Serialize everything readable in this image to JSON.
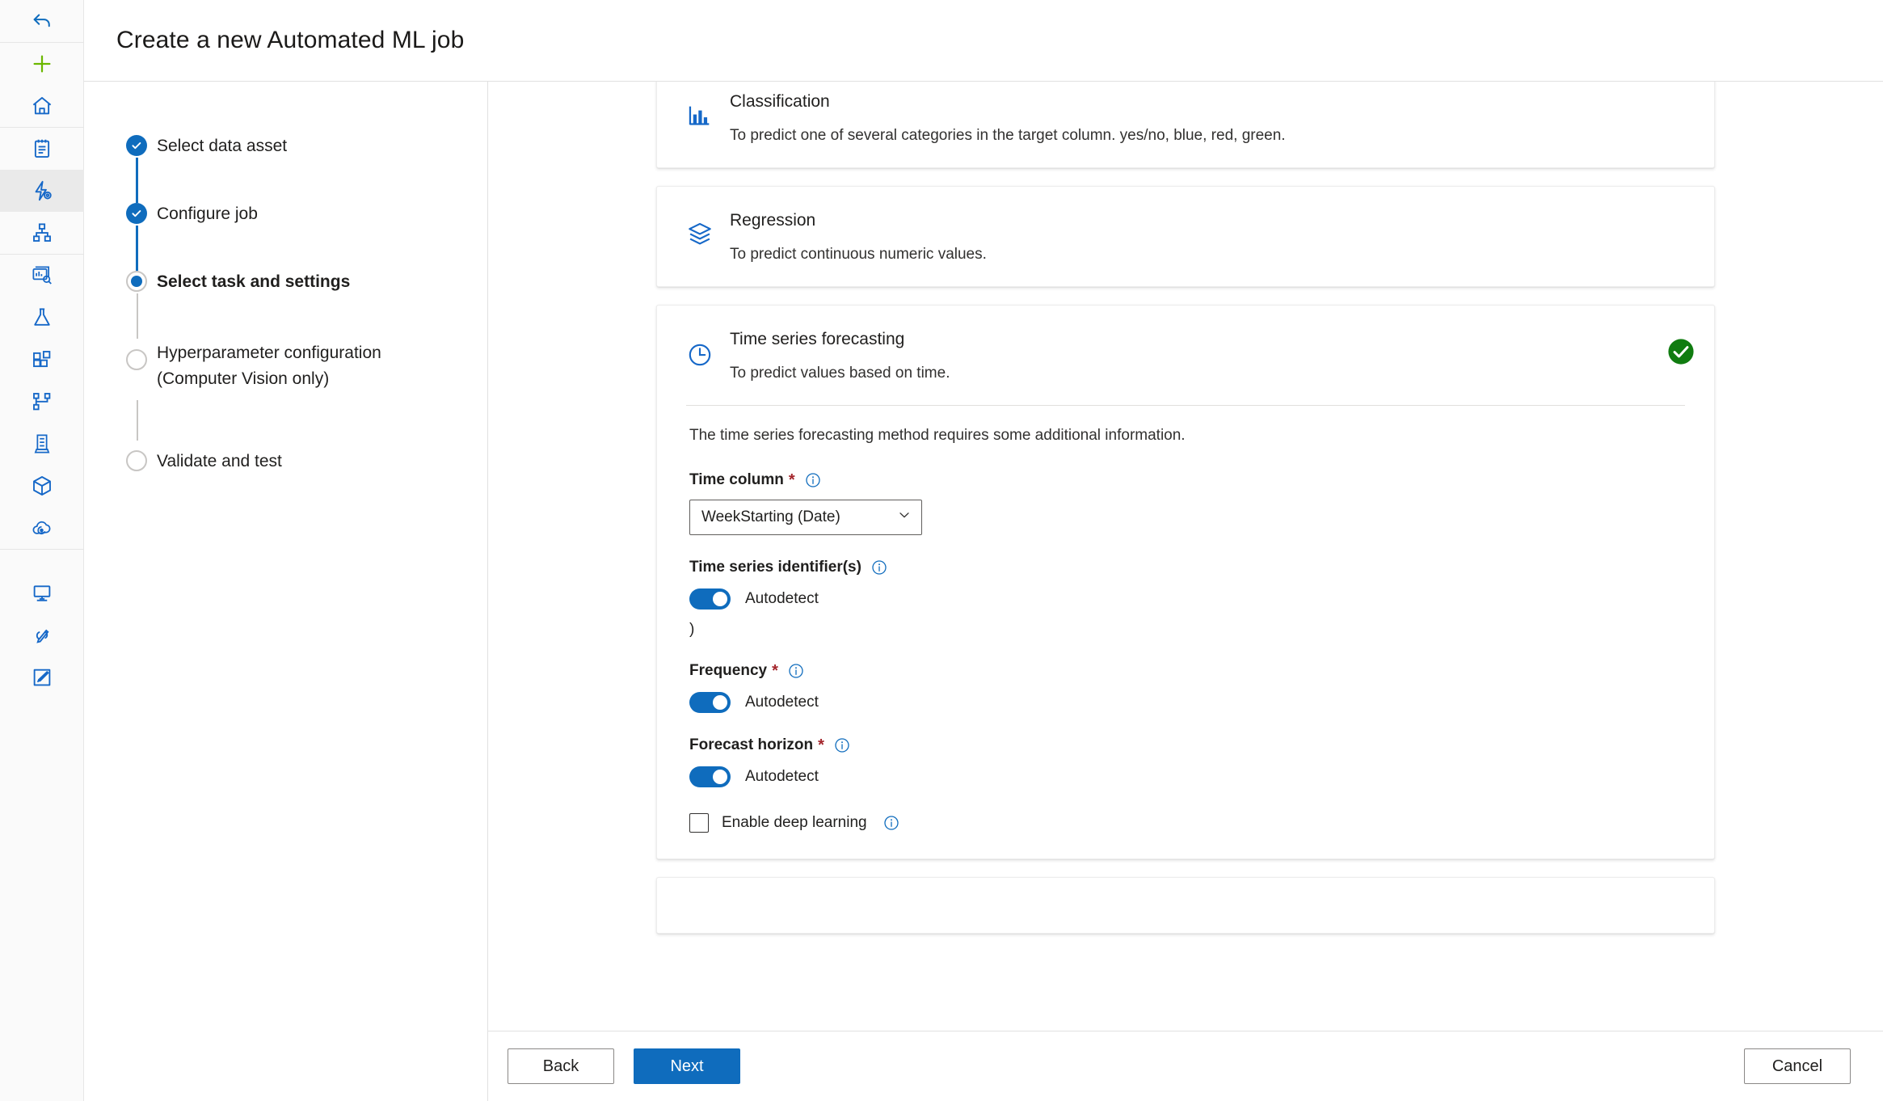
{
  "header": {
    "title": "Create a new Automated ML job"
  },
  "rail": {
    "items": [
      {
        "name": "back-arrow-icon",
        "label": "Back"
      },
      {
        "name": "add-new-icon",
        "label": "New"
      },
      {
        "name": "home-icon",
        "label": "Home"
      },
      {
        "name": "notebooks-icon",
        "label": "Notebooks"
      },
      {
        "name": "automated-ml-icon",
        "label": "Automated ML"
      },
      {
        "name": "designer-icon",
        "label": "Designer"
      },
      {
        "name": "data-monitoring-icon",
        "label": "Data monitoring"
      },
      {
        "name": "experiments-flask-icon",
        "label": "Jobs"
      },
      {
        "name": "components-icon",
        "label": "Components"
      },
      {
        "name": "pipelines-icon",
        "label": "Pipelines"
      },
      {
        "name": "data-icon",
        "label": "Data"
      },
      {
        "name": "models-cube-icon",
        "label": "Models"
      },
      {
        "name": "endpoints-cloud-icon",
        "label": "Endpoints"
      },
      {
        "name": "compute-monitor-icon",
        "label": "Compute"
      },
      {
        "name": "linked-services-icon",
        "label": "Linked Services"
      },
      {
        "name": "data-labeling-icon",
        "label": "Data Labeling"
      }
    ]
  },
  "steps": [
    {
      "label": "Select data asset",
      "state": "done"
    },
    {
      "label": "Configure job",
      "state": "done"
    },
    {
      "label": "Select task and settings",
      "state": "current"
    },
    {
      "label": "Hyperparameter configuration\n(Computer Vision only)",
      "state": "todo"
    },
    {
      "label": "Validate and test",
      "state": "todo"
    }
  ],
  "tasks": [
    {
      "title": "Classification",
      "description": "To predict one of several categories in the target column. yes/no, blue, red, green.",
      "icon": "bar-chart-icon",
      "selected": false
    },
    {
      "title": "Regression",
      "description": "To predict continuous numeric values.",
      "icon": "stacked-layers-icon",
      "selected": false
    },
    {
      "title": "Time series forecasting",
      "description": "To predict values based on time.",
      "icon": "clock-icon",
      "selected": true
    }
  ],
  "forecast_form": {
    "note": "The time series forecasting method requires some additional information.",
    "time_column": {
      "label": "Time column",
      "required_marker": "*",
      "value": "WeekStarting (Date)"
    },
    "time_series_identifiers": {
      "label": "Time series identifier(s)",
      "toggle_label": "Autodetect",
      "toggle_on": true,
      "stray_text": ")"
    },
    "frequency": {
      "label": "Frequency",
      "required_marker": "*",
      "toggle_label": "Autodetect",
      "toggle_on": true
    },
    "forecast_horizon": {
      "label": "Forecast horizon",
      "required_marker": "*",
      "toggle_label": "Autodetect",
      "toggle_on": true
    },
    "enable_deep_learning": {
      "label": "Enable deep learning",
      "checked": false
    }
  },
  "footer": {
    "back_label": "Back",
    "next_label": "Next",
    "cancel_label": "Cancel"
  },
  "colors": {
    "accent_blue": "#0f6cbd",
    "success_green": "#107c10",
    "required_red": "#a4262c",
    "add_green": "#6bb700"
  }
}
